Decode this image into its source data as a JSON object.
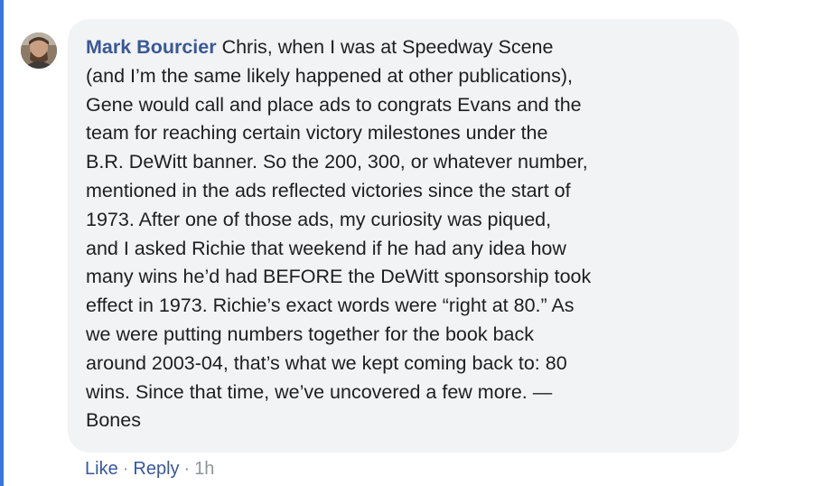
{
  "comment": {
    "author": "Mark Bourcier",
    "text": "Chris, when I was at Speedway Scene\n(and I’m the same likely happened at other publications),\nGene would call and place ads to congrats Evans and the\nteam for reaching certain victory milestones under the\nB.R. DeWitt banner. So the 200, 300, or whatever number,\nmentioned in the ads reflected victories since the start of\n1973. After one of those ads, my curiosity was piqued,\nand I asked Richie that weekend if he had any idea how\nmany wins he’d had BEFORE the DeWitt sponsorship took\neffect in 1973. Richie’s exact words were “right at 80.” As\nwe were putting numbers together for the book back\naround 2003-04, that’s what we kept coming back to: 80\nwins. Since that time, we’ve uncovered a few more. —\nBones"
  },
  "actions": {
    "like_label": "Like",
    "separator": "·",
    "reply_label": "Reply",
    "timestamp": "1h"
  },
  "colors": {
    "accent": "#385898",
    "bubble": "#f2f3f5",
    "thread_line": "#3578e5"
  },
  "icons": {
    "avatar": "user-avatar-photo"
  }
}
